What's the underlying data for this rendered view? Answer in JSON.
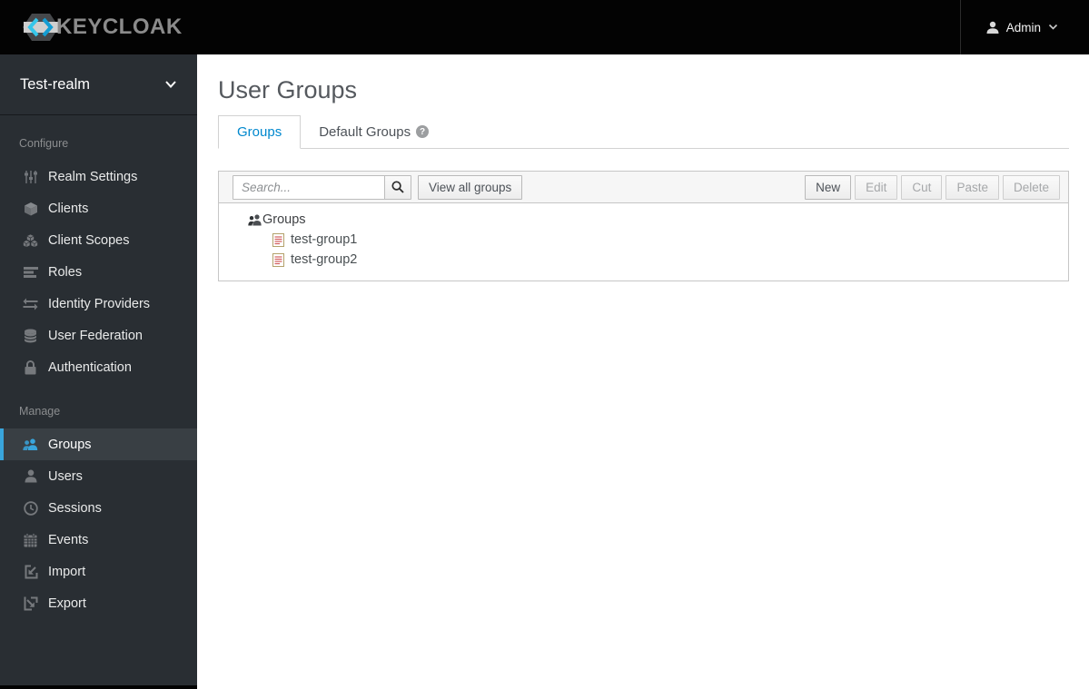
{
  "header": {
    "logo_text": "KEYCLOAK",
    "user_menu_label": "Admin"
  },
  "sidebar": {
    "realm": "Test-realm",
    "sections": [
      {
        "label": "Configure",
        "items": [
          {
            "label": "Realm Settings",
            "icon": "sliders-icon"
          },
          {
            "label": "Clients",
            "icon": "cube-icon"
          },
          {
            "label": "Client Scopes",
            "icon": "cubes-icon"
          },
          {
            "label": "Roles",
            "icon": "list-icon"
          },
          {
            "label": "Identity Providers",
            "icon": "exchange-icon"
          },
          {
            "label": "User Federation",
            "icon": "database-icon"
          },
          {
            "label": "Authentication",
            "icon": "lock-icon"
          }
        ]
      },
      {
        "label": "Manage",
        "items": [
          {
            "label": "Groups",
            "icon": "users-icon",
            "active": true
          },
          {
            "label": "Users",
            "icon": "user-icon"
          },
          {
            "label": "Sessions",
            "icon": "clock-icon"
          },
          {
            "label": "Events",
            "icon": "calendar-icon"
          },
          {
            "label": "Import",
            "icon": "import-icon"
          },
          {
            "label": "Export",
            "icon": "export-icon"
          }
        ]
      }
    ]
  },
  "main": {
    "title": "User Groups",
    "tabs": [
      {
        "label": "Groups",
        "active": true
      },
      {
        "label": "Default Groups",
        "has_help_icon": true
      }
    ],
    "toolbar": {
      "search_placeholder": "Search...",
      "view_all_label": "View all groups",
      "buttons": [
        {
          "label": "New",
          "enabled": true
        },
        {
          "label": "Edit",
          "enabled": false
        },
        {
          "label": "Cut",
          "enabled": false
        },
        {
          "label": "Paste",
          "enabled": false
        },
        {
          "label": "Delete",
          "enabled": false
        }
      ]
    },
    "tree": {
      "root_label": "Groups",
      "children": [
        "test-group1",
        "test-group2"
      ]
    }
  },
  "colors": {
    "accent_blue": "#0088ce",
    "nav_active_blue": "#39a5dc",
    "sidebar_bg": "#292e33",
    "header_bg": "#030303",
    "toolbar_bg": "#f6f6f6"
  }
}
